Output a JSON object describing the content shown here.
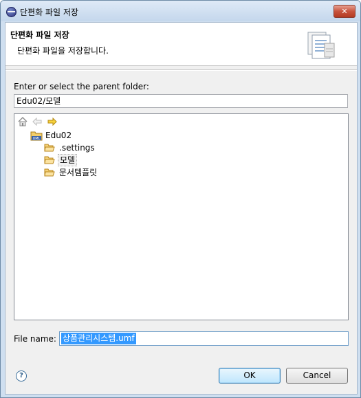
{
  "window": {
    "title": "단편화 파일 저장"
  },
  "banner": {
    "title": "단편화 파일 저장",
    "description": "단편화 파일을 저장합니다."
  },
  "folder": {
    "label": "Enter or select the parent folder:",
    "path_value": "Edu02/모델"
  },
  "tree": {
    "toolbar": {
      "home_icon": "home-icon",
      "back_icon": "back-arrow-icon",
      "forward_icon": "forward-arrow-icon"
    },
    "root": {
      "label": "Edu02",
      "icon": "uml-project-icon"
    },
    "children": [
      {
        "label": ".settings",
        "icon": "folder-icon"
      },
      {
        "label": "모델",
        "icon": "folder-icon",
        "selected": true
      },
      {
        "label": "문서템플릿",
        "icon": "folder-icon"
      }
    ]
  },
  "file": {
    "label": "File name:",
    "value": "상품관리시스템.umf"
  },
  "buttons": {
    "ok": "OK",
    "cancel": "Cancel",
    "help": "?"
  },
  "colors": {
    "selection": "#3399ff",
    "close": "#c7533d"
  }
}
